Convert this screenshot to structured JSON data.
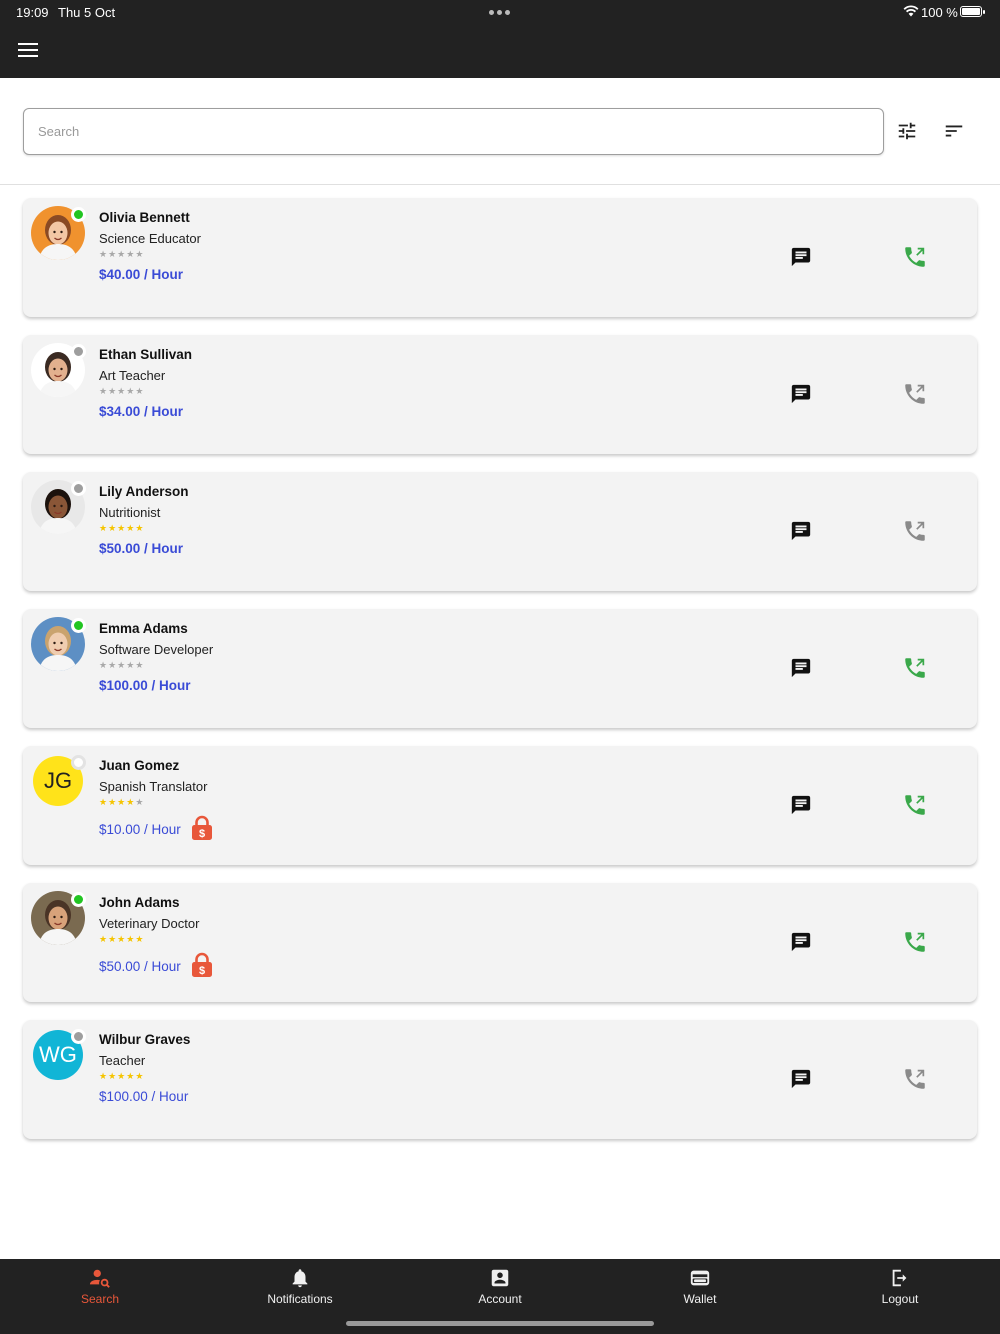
{
  "status_bar": {
    "time": "19:09",
    "date": "Thu 5 Oct",
    "battery": "100 %"
  },
  "search": {
    "placeholder": "Search",
    "value": ""
  },
  "colors": {
    "accent": "#e8573a",
    "price": "#3a4bd6",
    "call_active": "#3aa84a",
    "call_inactive": "#8a8a8a",
    "online": "#22c522",
    "offline": "#9e9e9e",
    "star": "#f5c400"
  },
  "providers": [
    {
      "name": "Olivia Bennett",
      "title": "Science Educator",
      "rating": 0,
      "price": "$40.00 / Hour",
      "status": "online",
      "call_available": true,
      "locked": false,
      "avatar": "photo",
      "avatar_bg": "#f0922e",
      "skin": "#f3c7a5",
      "hair": "#8a4a24"
    },
    {
      "name": "Ethan Sullivan",
      "title": "Art Teacher",
      "rating": 0,
      "price": "$34.00 / Hour",
      "status": "offline",
      "call_available": false,
      "locked": false,
      "avatar": "photo",
      "avatar_bg": "#ffffff",
      "skin": "#e2b08e",
      "hair": "#3a2a22"
    },
    {
      "name": "Lily Anderson",
      "title": "Nutritionist",
      "rating": 5,
      "price": "$50.00 / Hour",
      "status": "offline",
      "call_available": false,
      "locked": false,
      "avatar": "photo",
      "avatar_bg": "#e8e8e8",
      "skin": "#8a5637",
      "hair": "#1c120d"
    },
    {
      "name": "Emma Adams",
      "title": "Software Developer",
      "rating": 0,
      "price": "$100.00 / Hour",
      "status": "online",
      "call_available": true,
      "locked": false,
      "avatar": "photo",
      "avatar_bg": "#5d8fc4",
      "skin": "#f0cdb0",
      "hair": "#caa36e"
    },
    {
      "name": "Juan Gomez",
      "title": "Spanish Translator",
      "rating": 4,
      "price": "$10.00 / Hour",
      "status": "away",
      "call_available": true,
      "locked": true,
      "avatar": "initials",
      "initials": "JG",
      "avatar_bg": "#ffe31a",
      "initials_color": "#222222"
    },
    {
      "name": "John Adams",
      "title": "Veterinary Doctor",
      "rating": 5,
      "price": "$50.00 / Hour",
      "status": "online",
      "call_available": true,
      "locked": true,
      "avatar": "photo",
      "avatar_bg": "#7a6a50",
      "skin": "#d8a27a",
      "hair": "#4a3426"
    },
    {
      "name": "Wilbur Graves",
      "title": "Teacher",
      "rating": 5,
      "price": "$100.00 / Hour",
      "status": "offline",
      "call_available": false,
      "locked": false,
      "avatar": "initials",
      "initials": "WG",
      "avatar_bg": "#11b5d6",
      "initials_color": "#ffffff"
    }
  ],
  "bottom_nav": [
    {
      "label": "Search",
      "icon": "person-search-icon",
      "active": true
    },
    {
      "label": "Notifications",
      "icon": "bell-icon",
      "active": false
    },
    {
      "label": "Account",
      "icon": "account-box-icon",
      "active": false
    },
    {
      "label": "Wallet",
      "icon": "wallet-icon",
      "active": false
    },
    {
      "label": "Logout",
      "icon": "logout-icon",
      "active": false
    }
  ]
}
